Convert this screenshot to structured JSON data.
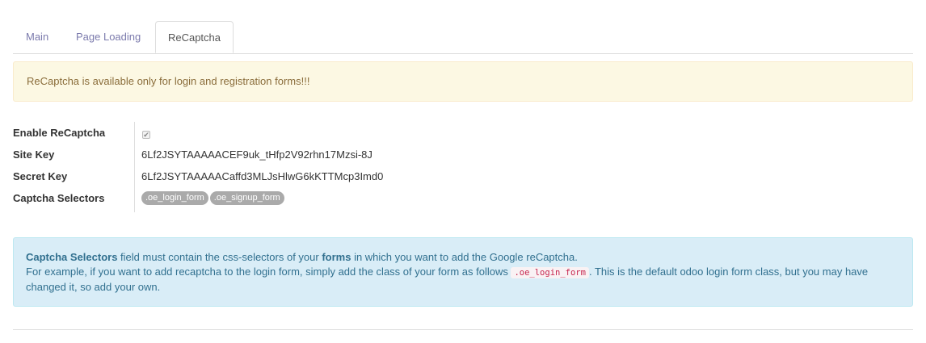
{
  "tabs": [
    {
      "label": "Main",
      "active": false
    },
    {
      "label": "Page Loading",
      "active": false
    },
    {
      "label": "ReCaptcha",
      "active": true
    }
  ],
  "warning": {
    "text": "ReCaptcha is available only for login and registration forms!!!"
  },
  "form": {
    "enable_label": "Enable ReCaptcha",
    "enable_checked": true,
    "site_key_label": "Site Key",
    "site_key_value": "6Lf2JSYTAAAAACEF9uk_tHfp2V92rhn17Mzsi-8J",
    "secret_key_label": "Secret Key",
    "secret_key_value": "6Lf2JSYTAAAAACaffd3MLJsHlwG6kKTTMcp3Imd0",
    "selectors_label": "Captcha Selectors",
    "selectors": [
      ".oe_login_form",
      ".oe_signup_form"
    ]
  },
  "info": {
    "bold1": "Captcha Selectors",
    "text1": " field must contain the css-selectors of your ",
    "bold2": "forms",
    "text2": " in which you want to add the Google reCaptcha.",
    "text3": "For example, if you want to add recaptcha to the login form, simply add the class of your form as follows ",
    "code": ".oe_login_form",
    "text4": ". This is the default odoo login form class, but you may have changed it, so add your own."
  },
  "colors": {
    "tab_link": "#7c7bad",
    "warning_bg": "#fcf8e3",
    "warning_text": "#8a6d3b",
    "info_bg": "#d9edf7",
    "info_text": "#31708f",
    "tag_bg": "#aaaaaa"
  }
}
